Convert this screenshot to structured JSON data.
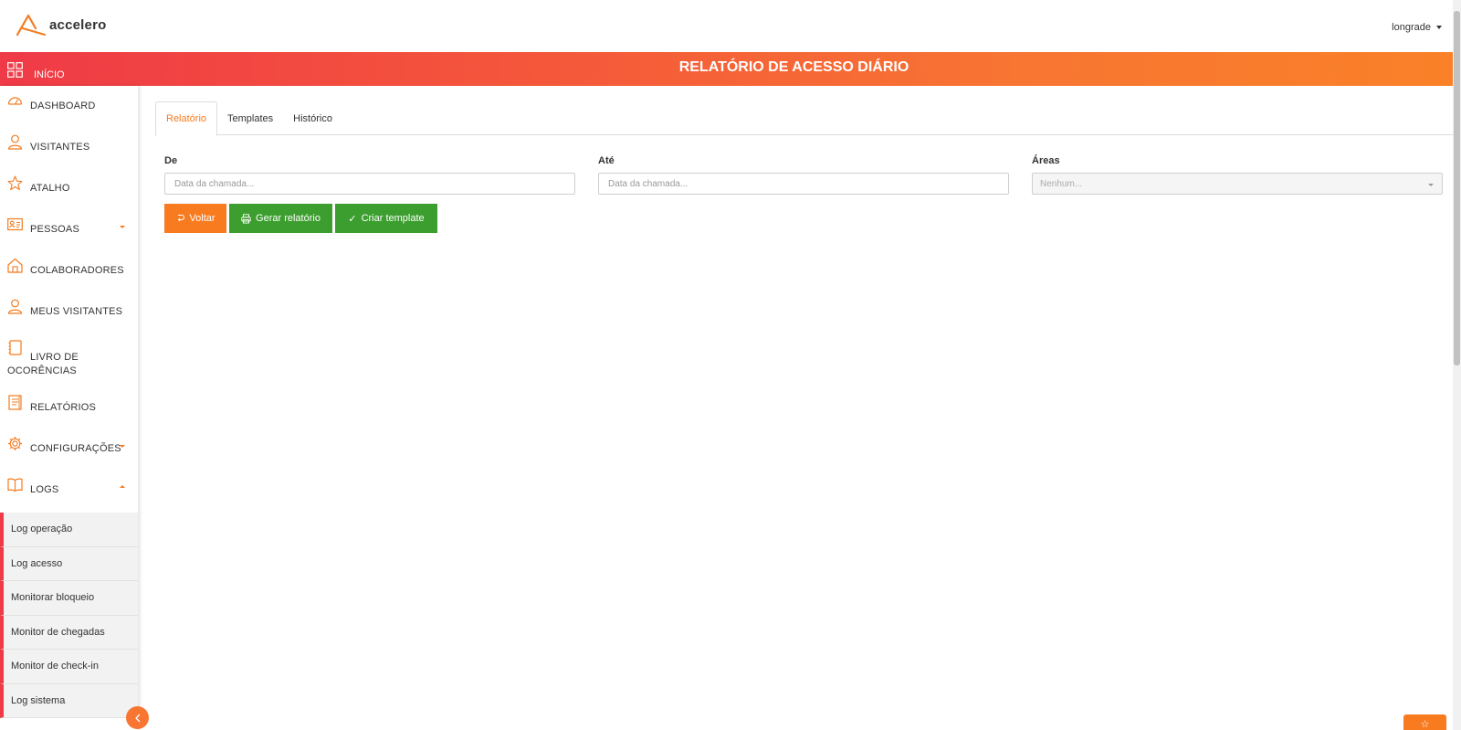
{
  "header": {
    "logo_text": "accelero",
    "user_name": "longrade"
  },
  "banner": {
    "home_label": "INÍCIO",
    "page_title": "RELATÓRIO DE ACESSO DIÁRIO"
  },
  "sidebar": {
    "items": [
      {
        "label": "DASHBOARD",
        "icon": "dashboard-icon"
      },
      {
        "label": "VISITANTES",
        "icon": "user-icon"
      },
      {
        "label": "ATALHO",
        "icon": "star-icon"
      },
      {
        "label": "PESSOAS",
        "icon": "id-card-icon",
        "expandable": true
      },
      {
        "label": "COLABORADORES",
        "icon": "building-icon"
      },
      {
        "label": "MEUS VISITANTES",
        "icon": "user-icon"
      },
      {
        "label": "LIVRO DE OCORÊNCIAS",
        "icon": "book-icon"
      },
      {
        "label": "RELATÓRIOS",
        "icon": "report-icon"
      },
      {
        "label": "CONFIGURAÇÕES",
        "icon": "gear-icon",
        "expandable": true
      },
      {
        "label": "LOGS",
        "icon": "open-book-icon",
        "expanded": true
      }
    ],
    "logs_submenu": [
      "Log operação",
      "Log acesso",
      "Monitorar bloqueio",
      "Monitor de chegadas",
      "Monitor de check-in",
      "Log sistema"
    ]
  },
  "tabs": [
    {
      "label": "Relatório",
      "active": true
    },
    {
      "label": "Templates",
      "active": false
    },
    {
      "label": "Histórico",
      "active": false
    }
  ],
  "form": {
    "from_label": "De",
    "from_placeholder": "Data da chamada...",
    "to_label": "Até",
    "to_placeholder": "Data da chamada...",
    "areas_label": "Áreas",
    "areas_value": "Nenhum..."
  },
  "buttons": {
    "back": "Voltar",
    "generate": "Gerar relatório",
    "create_template": "Criar template"
  },
  "colors": {
    "accent": "#f87b20",
    "banner_start": "#ef3a47",
    "banner_end": "#fa8128",
    "success": "#3c9e2f"
  }
}
